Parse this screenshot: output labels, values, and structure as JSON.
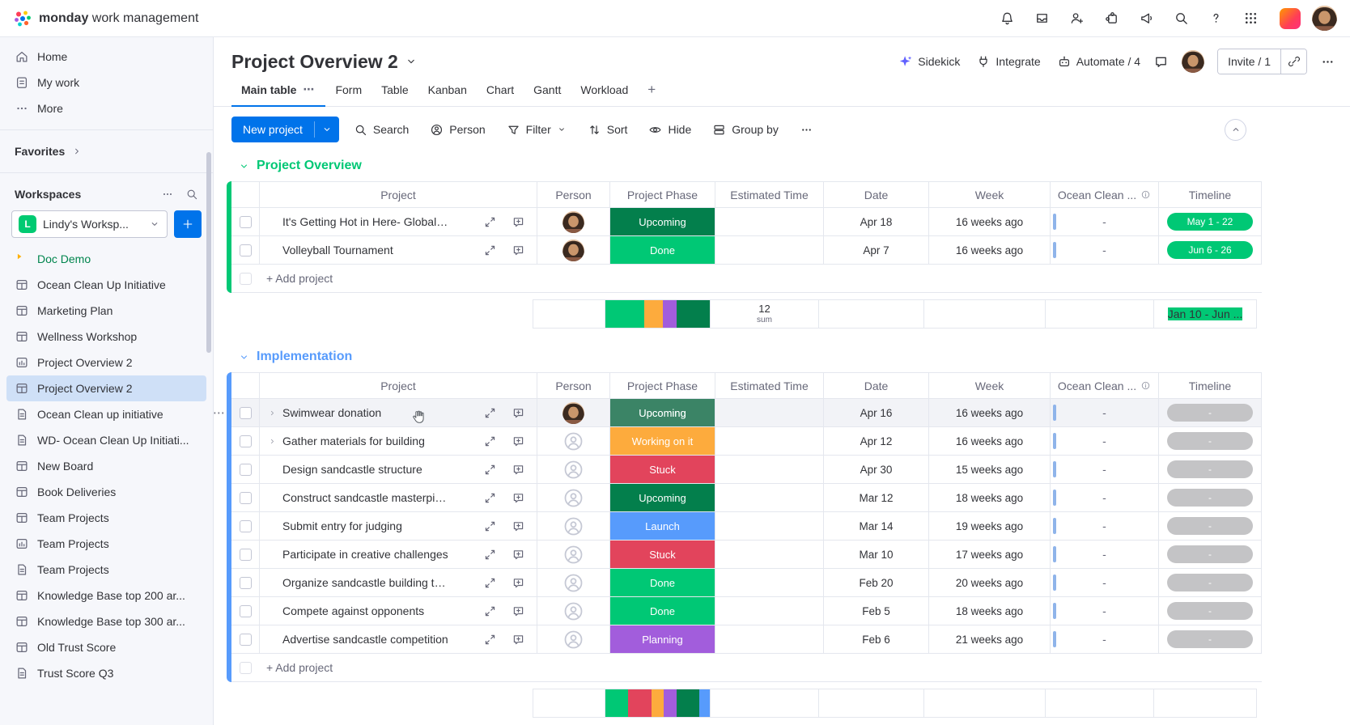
{
  "colors": {
    "accent": "#0073ea",
    "done": "#00c875",
    "upcoming": "#037f4c",
    "working": "#fdab3d",
    "stuck": "#e2445c",
    "launch": "#579bfc",
    "planning": "#a25ddc",
    "timeline_empty": "#c4c4c6"
  },
  "topbar": {
    "brand_bold": "monday",
    "brand_rest": "work management",
    "right_icons": [
      {
        "name": "notifications-bell-icon",
        "icon": "bell-icon"
      },
      {
        "name": "inbox-icon",
        "icon": "inbox-icon"
      },
      {
        "name": "invite-members-icon",
        "icon": "person-add-icon"
      },
      {
        "name": "apps-marketplace-icon",
        "icon": "apps-icon"
      },
      {
        "name": "whats-new-icon",
        "icon": "megaphone-icon"
      },
      {
        "name": "search-icon",
        "icon": "search-icon"
      },
      {
        "name": "help-icon",
        "icon": "help-icon"
      },
      {
        "name": "product-switcher-icon",
        "icon": "grid-icon"
      }
    ]
  },
  "sidebar": {
    "nav": [
      {
        "label": "Home",
        "icon": "home-icon"
      },
      {
        "label": "My work",
        "icon": "mywork-icon"
      },
      {
        "label": "More",
        "icon": "more-icon"
      }
    ],
    "favorites_label": "Favorites",
    "workspaces_label": "Workspaces",
    "workspace": {
      "initial": "L",
      "name": "Lindy's Worksp...",
      "color": "#00ca72"
    },
    "items": [
      {
        "label": "Doc Demo",
        "icon": "caret-solid-icon",
        "category": true
      },
      {
        "label": "Ocean Clean Up Initiative",
        "icon": "board-icon"
      },
      {
        "label": "Marketing Plan",
        "icon": "board-icon"
      },
      {
        "label": "Wellness Workshop",
        "icon": "board-icon"
      },
      {
        "label": "Project Overview 2",
        "icon": "board-chart-icon"
      },
      {
        "label": "Project Overview 2",
        "icon": "board-icon",
        "selected": true
      },
      {
        "label": "Ocean Clean up initiative",
        "icon": "doc-icon"
      },
      {
        "label": "WD- Ocean Clean Up Initiati...",
        "icon": "doc-icon"
      },
      {
        "label": "New Board",
        "icon": "board-icon"
      },
      {
        "label": "Book Deliveries",
        "icon": "board-icon"
      },
      {
        "label": "Team Projects",
        "icon": "board-icon"
      },
      {
        "label": "Team Projects",
        "icon": "board-chart-icon"
      },
      {
        "label": "Team Projects",
        "icon": "doc-icon"
      },
      {
        "label": "Knowledge Base top 200 ar...",
        "icon": "board-icon"
      },
      {
        "label": "Knowledge Base top 300 ar...",
        "icon": "board-icon"
      },
      {
        "label": "Old Trust Score",
        "icon": "board-icon"
      },
      {
        "label": "Trust Score Q3",
        "icon": "doc-icon"
      }
    ]
  },
  "board": {
    "title": "Project Overview 2",
    "tabs": [
      {
        "label": "Main table",
        "active": true
      },
      {
        "label": "Form"
      },
      {
        "label": "Table"
      },
      {
        "label": "Kanban"
      },
      {
        "label": "Chart"
      },
      {
        "label": "Gantt"
      },
      {
        "label": "Workload"
      },
      {
        "label": "+",
        "add": true
      }
    ],
    "actions": [
      {
        "label": "Sidekick",
        "icon": "sparkle-icon",
        "color": "#6161ff"
      },
      {
        "label": "Integrate",
        "icon": "integrate-icon"
      },
      {
        "label": "Automate / 4",
        "icon": "automate-icon"
      }
    ],
    "invite_label": "Invite / 1"
  },
  "toolbar": {
    "new_project_label": "New project",
    "buttons": [
      {
        "label": "Search",
        "icon": "search-icon"
      },
      {
        "label": "Person",
        "icon": "person-icon"
      },
      {
        "label": "Filter",
        "icon": "filter-icon",
        "caret": true
      },
      {
        "label": "Sort",
        "icon": "sort-icon"
      },
      {
        "label": "Hide",
        "icon": "hide-icon"
      },
      {
        "label": "Group by",
        "icon": "groupby-icon"
      },
      {
        "label": "",
        "icon": "dots-icon",
        "name": "more-options"
      }
    ]
  },
  "table": {
    "columns": [
      {
        "label": "Project"
      },
      {
        "label": "Person"
      },
      {
        "label": "Project Phase"
      },
      {
        "label": "Estimated Time"
      },
      {
        "label": "Date"
      },
      {
        "label": "Week"
      },
      {
        "label": "Ocean Clean ...",
        "info": true
      },
      {
        "label": "Timeline"
      }
    ],
    "add_row_label": "+ Add project"
  },
  "groups": [
    {
      "name": "Project Overview",
      "color": "#00c875",
      "rows": [
        {
          "project": "It's Getting Hot in Here- Global ...",
          "avatar": true,
          "phase": {
            "label": "Upcoming",
            "color": "#037f4c"
          },
          "date": "Apr 18",
          "week": "16 weeks ago",
          "ocean": "-",
          "timeline": {
            "label": "May 1 - 22",
            "color": "#00c875"
          }
        },
        {
          "project": "Volleyball Tournament",
          "avatar": true,
          "phase": {
            "label": "Done",
            "color": "#00c875"
          },
          "date": "Apr 7",
          "week": "16 weeks ago",
          "ocean": "-",
          "timeline": {
            "label": "Jun 6 - 26",
            "color": "#00c875"
          }
        }
      ],
      "summary": {
        "distribution": [
          {
            "color": "#00c875",
            "pct": 37
          },
          {
            "color": "#fdab3d",
            "pct": 18
          },
          {
            "color": "#a25ddc",
            "pct": 13
          },
          {
            "color": "#037f4c",
            "pct": 32
          }
        ],
        "estimated": {
          "value": "12",
          "label": "sum"
        },
        "timeline": {
          "label": "Jan 10 - Jun ...",
          "color": "#00c875"
        }
      }
    },
    {
      "name": "Implementation",
      "color": "#579bfc",
      "rows": [
        {
          "project": "Swimwear donation",
          "avatar": true,
          "expand": true,
          "hovered": true,
          "phase": {
            "label": "Upcoming",
            "color": "#037f4c"
          },
          "date": "Apr 16",
          "week": "16 weeks ago",
          "ocean": "-",
          "timeline": {
            "label": "-",
            "color": "#c4c4c6"
          }
        },
        {
          "project": "Gather materials for building",
          "expand": true,
          "phase": {
            "label": "Working on it",
            "color": "#fdab3d"
          },
          "date": "Apr 12",
          "week": "16 weeks ago",
          "ocean": "-",
          "timeline": {
            "label": "-",
            "color": "#c4c4c6"
          }
        },
        {
          "project": "Design sandcastle structure",
          "phase": {
            "label": "Stuck",
            "color": "#e2445c"
          },
          "date": "Apr 30",
          "week": "15 weeks ago",
          "ocean": "-",
          "timeline": {
            "label": "-",
            "color": "#c4c4c6"
          }
        },
        {
          "project": "Construct sandcastle masterpiece",
          "phase": {
            "label": "Upcoming",
            "color": "#037f4c"
          },
          "date": "Mar 12",
          "week": "18 weeks ago",
          "ocean": "-",
          "timeline": {
            "label": "-",
            "color": "#c4c4c6"
          }
        },
        {
          "project": "Submit entry for judging",
          "phase": {
            "label": "Launch",
            "color": "#579bfc"
          },
          "date": "Mar 14",
          "week": "19 weeks ago",
          "ocean": "-",
          "timeline": {
            "label": "-",
            "color": "#c4c4c6"
          }
        },
        {
          "project": "Participate in creative challenges",
          "phase": {
            "label": "Stuck",
            "color": "#e2445c"
          },
          "date": "Mar 10",
          "week": "17 weeks ago",
          "ocean": "-",
          "timeline": {
            "label": "-",
            "color": "#c4c4c6"
          }
        },
        {
          "project": "Organize sandcastle building team",
          "phase": {
            "label": "Done",
            "color": "#00c875"
          },
          "date": "Feb 20",
          "week": "20 weeks ago",
          "ocean": "-",
          "timeline": {
            "label": "-",
            "color": "#c4c4c6"
          }
        },
        {
          "project": "Compete against opponents",
          "phase": {
            "label": "Done",
            "color": "#00c875"
          },
          "date": "Feb 5",
          "week": "18 weeks ago",
          "ocean": "-",
          "timeline": {
            "label": "-",
            "color": "#c4c4c6"
          }
        },
        {
          "project": "Advertise sandcastle competition",
          "phase": {
            "label": "Planning",
            "color": "#a25ddc"
          },
          "date": "Feb 6",
          "week": "21 weeks ago",
          "ocean": "-",
          "timeline": {
            "label": "-",
            "color": "#c4c4c6"
          }
        }
      ],
      "summary": {
        "distribution": [
          {
            "color": "#00c875",
            "pct": 22
          },
          {
            "color": "#e2445c",
            "pct": 22
          },
          {
            "color": "#fdab3d",
            "pct": 12
          },
          {
            "color": "#a25ddc",
            "pct": 12
          },
          {
            "color": "#037f4c",
            "pct": 22
          },
          {
            "color": "#579bfc",
            "pct": 10
          }
        ]
      }
    }
  ]
}
